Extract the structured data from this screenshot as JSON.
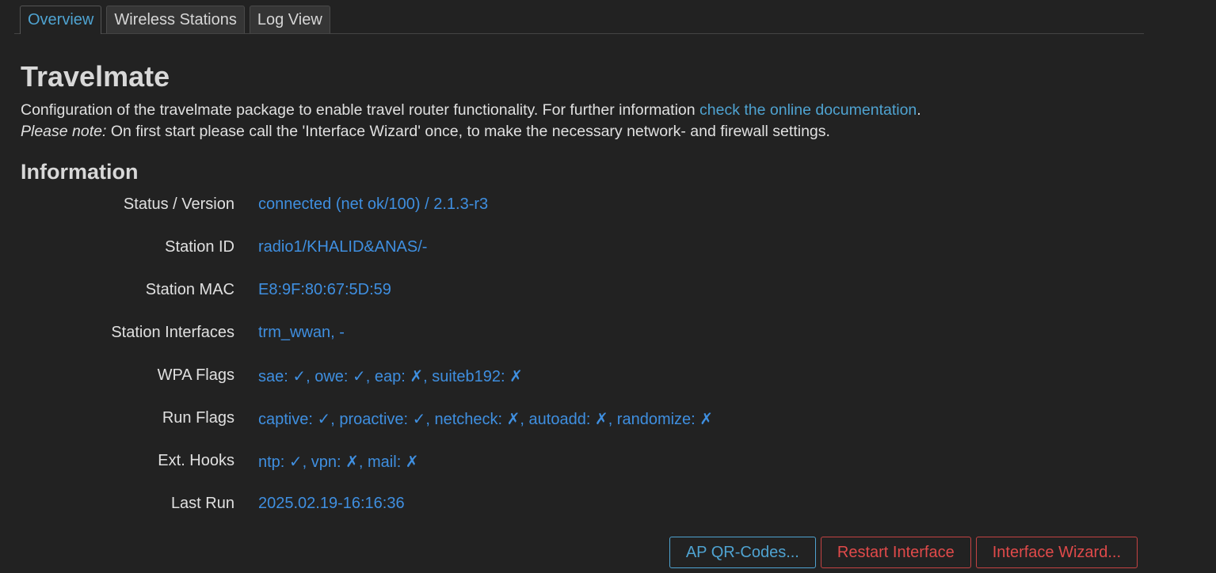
{
  "tabs": [
    {
      "label": "Overview",
      "active": true
    },
    {
      "label": "Wireless Stations",
      "active": false
    },
    {
      "label": "Log View",
      "active": false
    }
  ],
  "header": {
    "title": "Travelmate",
    "description_text": "Configuration of the travelmate package to enable travel router functionality. For further information ",
    "doc_link": "check the online documentation",
    "description_end": ".",
    "note_label": "Please note:",
    "note_text": " On first start please call the 'Interface Wizard' once, to make the necessary network- and firewall settings."
  },
  "information": {
    "title": "Information",
    "rows": [
      {
        "label": "Status / Version",
        "value": "connected (net ok/100) / 2.1.3-r3"
      },
      {
        "label": "Station ID",
        "value": "radio1/KHALID&ANAS/-"
      },
      {
        "label": "Station MAC",
        "value": "E8:9F:80:67:5D:59"
      },
      {
        "label": "Station Interfaces",
        "value": "trm_wwan, -"
      },
      {
        "label": "WPA Flags",
        "value": "sae: ✓, owe: ✓, eap: ✗, suiteb192: ✗"
      },
      {
        "label": "Run Flags",
        "value": "captive: ✓, proactive: ✓, netcheck: ✗, autoadd: ✗, randomize: ✗"
      },
      {
        "label": "Ext. Hooks",
        "value": "ntp: ✓, vpn: ✗, mail: ✗"
      },
      {
        "label": "Last Run",
        "value": "2025.02.19-16:16:36"
      }
    ]
  },
  "buttons": {
    "qr": "AP QR-Codes...",
    "restart": "Restart Interface",
    "wizard": "Interface Wizard..."
  },
  "colors": {
    "background": "#222222",
    "link": "#4fa3d1",
    "value": "#3f8fe0",
    "danger": "#e04a4a"
  }
}
